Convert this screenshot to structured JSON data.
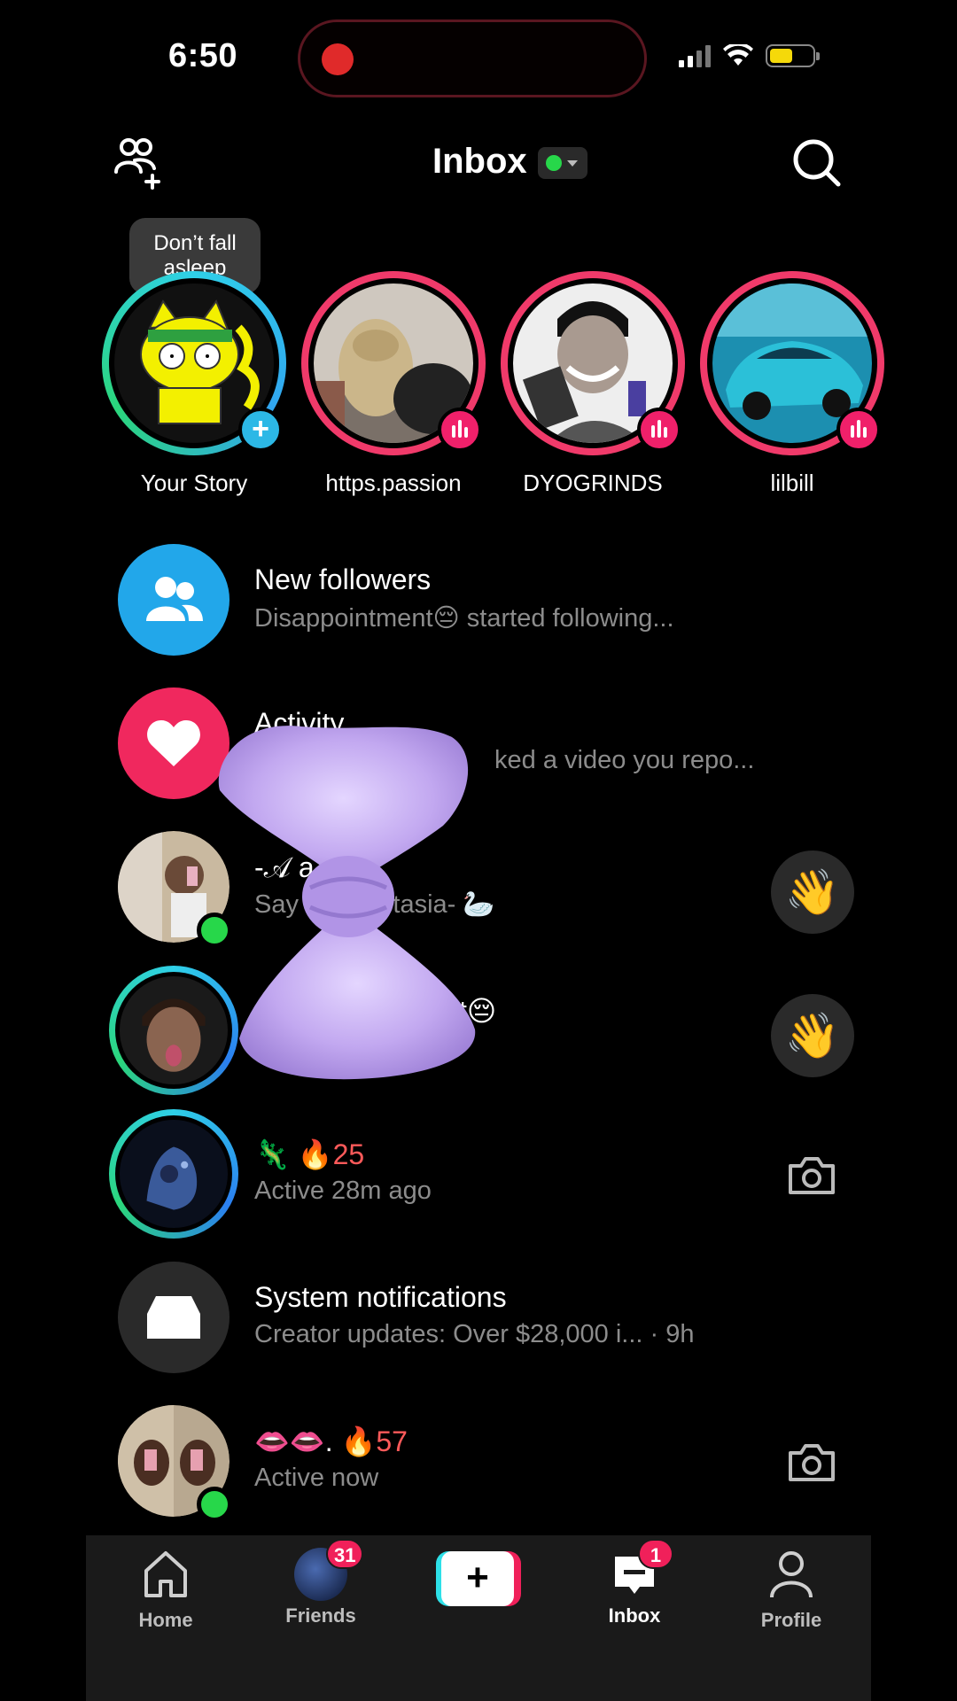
{
  "status_bar": {
    "time": "6:50"
  },
  "header": {
    "title": "Inbox"
  },
  "stories": {
    "tooltip": "Don’t fall asleep",
    "items": [
      {
        "label": "Your Story"
      },
      {
        "label": "https.passion"
      },
      {
        "label": "DYOGRINDS"
      },
      {
        "label": "lilbill"
      }
    ]
  },
  "inbox": {
    "new_followers": {
      "title": "New followers",
      "subtitle": "Disappointment😔 started following..."
    },
    "activity": {
      "title": "Activity",
      "subtitle": "ked a video you repo..."
    },
    "chat_anastasia": {
      "title": "-𝒜 a- 🦢",
      "subtitle": "Say h 𝒜nastasia- 🦢"
    },
    "chat_disappointment": {
      "title": "t😔"
    },
    "chat_lizard": {
      "title": "🦎 ",
      "streak": "🔥25",
      "subtitle": "Active 28m ago"
    },
    "system": {
      "title": "System notifications",
      "subtitle": "Creator updates: Over $28,000 i... · 9h"
    },
    "chat_lips": {
      "title": "👄👄. ",
      "streak": "🔥57",
      "subtitle": "Active now"
    }
  },
  "bottom_nav": {
    "home": "Home",
    "friends": "Friends",
    "friends_badge": "31",
    "create": "+",
    "inbox": "Inbox",
    "inbox_badge": "1",
    "profile": "Profile"
  }
}
